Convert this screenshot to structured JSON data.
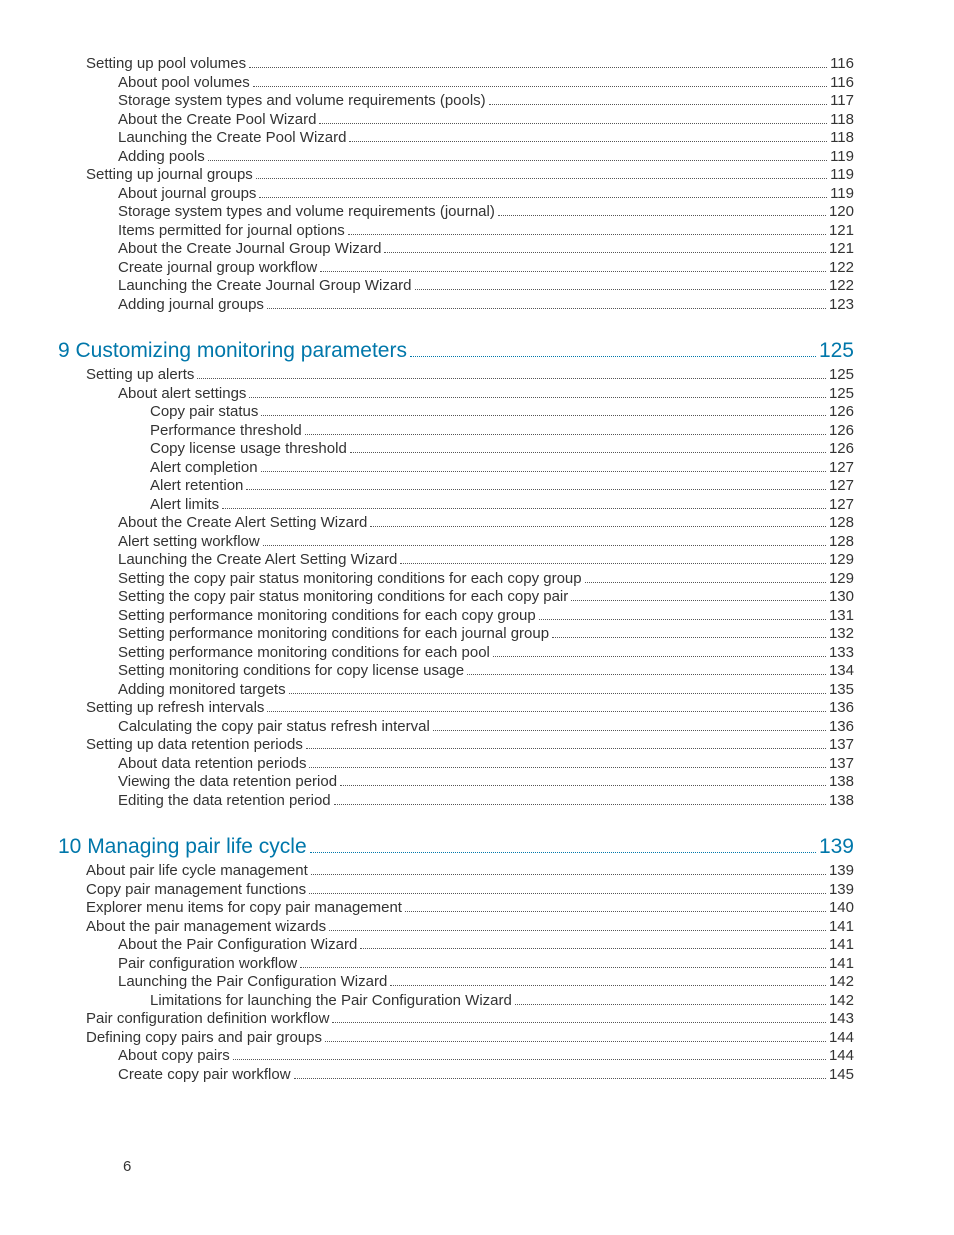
{
  "pageNumber": "6",
  "entries": [
    {
      "level": 1,
      "title": "Setting up pool volumes",
      "page": "116"
    },
    {
      "level": 2,
      "title": "About pool volumes",
      "page": "116"
    },
    {
      "level": 2,
      "title": "Storage system types and volume requirements (pools)",
      "page": "117"
    },
    {
      "level": 2,
      "title": "About the Create Pool Wizard",
      "page": "118"
    },
    {
      "level": 2,
      "title": "Launching the Create Pool Wizard",
      "page": "118"
    },
    {
      "level": 2,
      "title": "Adding pools",
      "page": "119"
    },
    {
      "level": 1,
      "title": "Setting up journal groups",
      "page": "119"
    },
    {
      "level": 2,
      "title": "About journal groups",
      "page": "119"
    },
    {
      "level": 2,
      "title": "Storage system types and volume requirements (journal)",
      "page": "120"
    },
    {
      "level": 2,
      "title": "Items permitted for journal options",
      "page": "121"
    },
    {
      "level": 2,
      "title": "About the Create Journal Group Wizard",
      "page": "121"
    },
    {
      "level": 2,
      "title": "Create journal group workflow",
      "page": "122"
    },
    {
      "level": 2,
      "title": "Launching the Create Journal Group Wizard",
      "page": "122"
    },
    {
      "level": 2,
      "title": "Adding journal groups",
      "page": "123"
    },
    {
      "level": 0,
      "title": "9 Customizing monitoring parameters",
      "page": "125"
    },
    {
      "level": 1,
      "title": "Setting up alerts",
      "page": "125"
    },
    {
      "level": 2,
      "title": "About alert settings",
      "page": "125"
    },
    {
      "level": 3,
      "title": "Copy pair status",
      "page": "126"
    },
    {
      "level": 3,
      "title": "Performance threshold",
      "page": "126"
    },
    {
      "level": 3,
      "title": "Copy license usage threshold",
      "page": "126"
    },
    {
      "level": 3,
      "title": "Alert completion",
      "page": "127"
    },
    {
      "level": 3,
      "title": "Alert retention",
      "page": "127"
    },
    {
      "level": 3,
      "title": "Alert limits",
      "page": "127"
    },
    {
      "level": 2,
      "title": "About the Create Alert Setting Wizard",
      "page": "128"
    },
    {
      "level": 2,
      "title": "Alert setting workflow ",
      "page": "128"
    },
    {
      "level": 2,
      "title": "Launching the Create Alert Setting Wizard",
      "page": "129"
    },
    {
      "level": 2,
      "title": "Setting the copy pair status monitoring conditions for each copy group",
      "page": "129"
    },
    {
      "level": 2,
      "title": "Setting the copy pair status monitoring conditions for each copy pair",
      "page": "130"
    },
    {
      "level": 2,
      "title": "Setting performance monitoring conditions for each copy group",
      "page": "131"
    },
    {
      "level": 2,
      "title": "Setting performance monitoring conditions for each journal group",
      "page": "132"
    },
    {
      "level": 2,
      "title": "Setting performance monitoring conditions for each pool",
      "page": "133"
    },
    {
      "level": 2,
      "title": "Setting monitoring conditions for copy license usage",
      "page": "134"
    },
    {
      "level": 2,
      "title": "Adding monitored targets",
      "page": "135"
    },
    {
      "level": 1,
      "title": "Setting up refresh intervals",
      "page": "136"
    },
    {
      "level": 2,
      "title": "Calculating the copy pair status refresh interval",
      "page": "136"
    },
    {
      "level": 1,
      "title": "Setting up data retention periods",
      "page": "137"
    },
    {
      "level": 2,
      "title": "About data retention periods",
      "page": "137"
    },
    {
      "level": 2,
      "title": "Viewing the data retention period",
      "page": "138"
    },
    {
      "level": 2,
      "title": "Editing the data retention period",
      "page": "138"
    },
    {
      "level": 0,
      "title": "10 Managing pair life cycle",
      "page": "139"
    },
    {
      "level": 1,
      "title": "About pair life cycle management",
      "page": "139"
    },
    {
      "level": 1,
      "title": "Copy pair management functions",
      "page": "139"
    },
    {
      "level": 1,
      "title": "Explorer menu items for copy pair management ",
      "page": "140"
    },
    {
      "level": 1,
      "title": "About the pair management wizards",
      "page": "141"
    },
    {
      "level": 2,
      "title": "About the Pair Configuration Wizard",
      "page": "141"
    },
    {
      "level": 2,
      "title": "Pair configuration workflow",
      "page": "141"
    },
    {
      "level": 2,
      "title": "Launching the Pair Configuration Wizard",
      "page": "142"
    },
    {
      "level": 3,
      "title": "Limitations for launching the Pair Configuration Wizard",
      "page": "142"
    },
    {
      "level": 1,
      "title": "Pair configuration definition workflow",
      "page": "143"
    },
    {
      "level": 1,
      "title": "Defining copy pairs and pair groups",
      "page": "144"
    },
    {
      "level": 2,
      "title": "About copy pairs",
      "page": "144"
    },
    {
      "level": 2,
      "title": "Create copy pair workflow",
      "page": "145"
    }
  ]
}
